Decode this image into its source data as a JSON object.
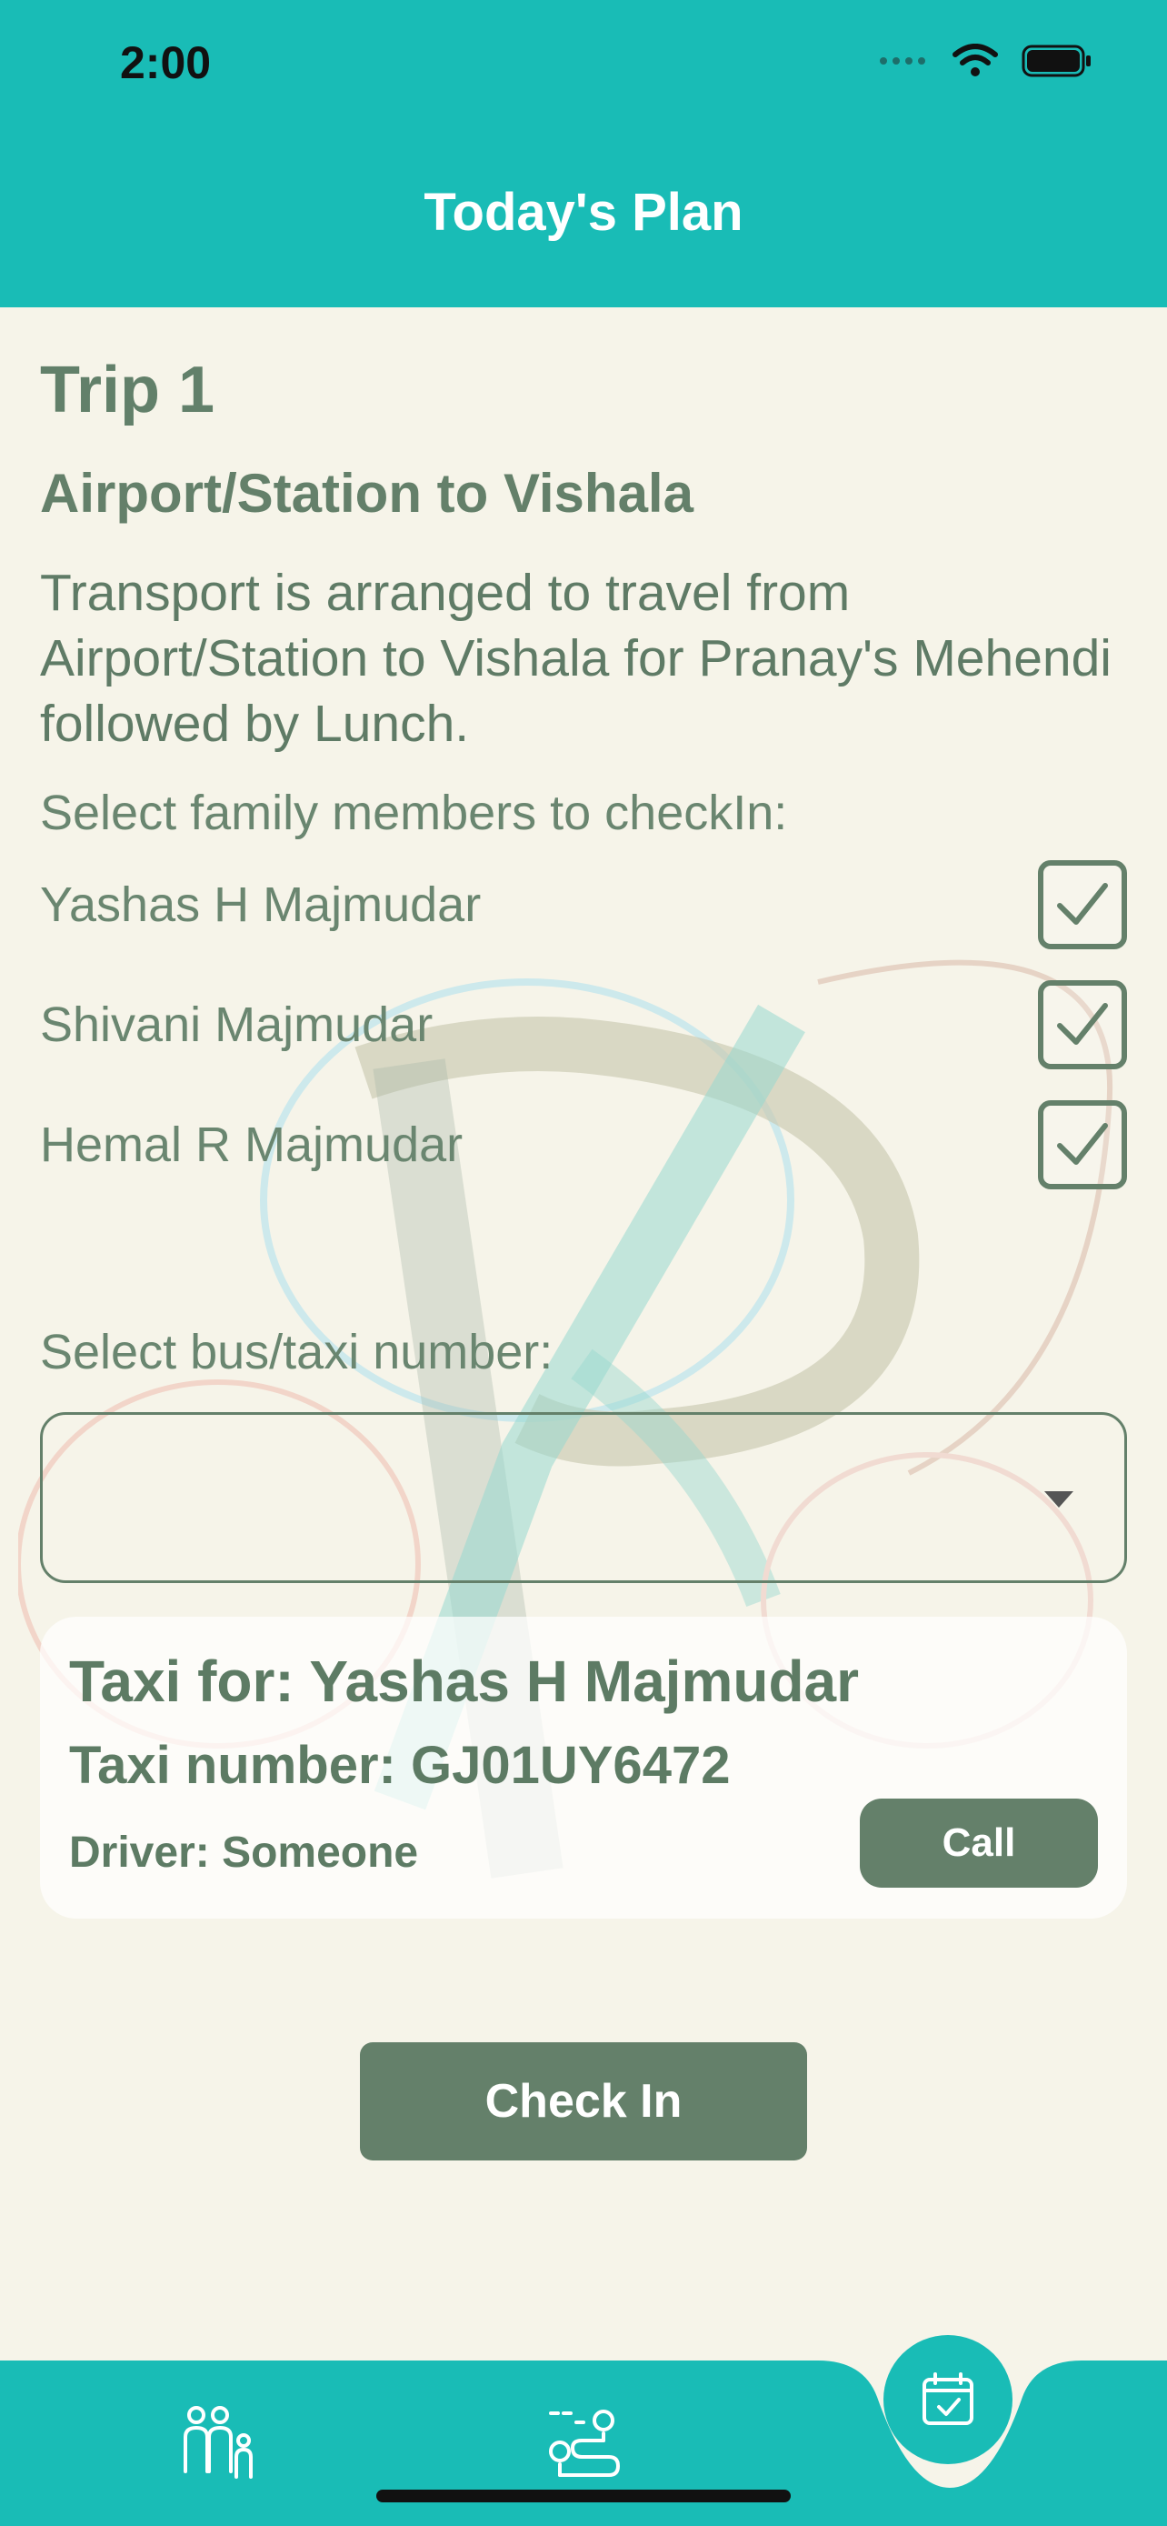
{
  "status_bar": {
    "time": "2:00"
  },
  "header": {
    "title": "Today's Plan"
  },
  "trip": {
    "title": "Trip 1",
    "route": "Airport/Station to Vishala",
    "description": "Transport is arranged to travel from Airport/Station to Vishala for Pranay's Mehendi followed by Lunch."
  },
  "family": {
    "label": "Select family members to checkIn:",
    "members": [
      {
        "name": "Yashas H Majmudar",
        "checked": true
      },
      {
        "name": "Shivani Majmudar",
        "checked": true
      },
      {
        "name": "Hemal R Majmudar",
        "checked": true
      }
    ]
  },
  "bus_select": {
    "label": "Select bus/taxi number:",
    "value": ""
  },
  "taxi": {
    "for": "Taxi for: Yashas H Majmudar",
    "number": "Taxi number: GJ01UY6472",
    "driver": "Driver: Someone",
    "call_label": "Call"
  },
  "checkin_label": "Check In",
  "colors": {
    "header": "#19bcb6",
    "accent": "#64806a",
    "background": "#f6f4e9"
  },
  "tab_bar": {
    "items": [
      {
        "icon": "family-icon",
        "active": false
      },
      {
        "icon": "route-map-icon",
        "active": false
      },
      {
        "icon": "calendar-check-icon",
        "active": true
      }
    ]
  }
}
